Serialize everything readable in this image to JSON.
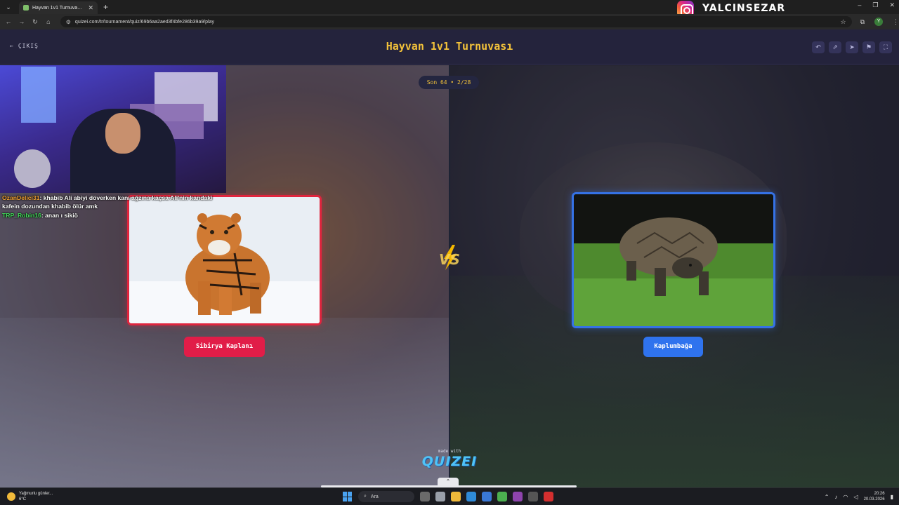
{
  "browser": {
    "tab_title": "Hayvan 1v1 Turnuvası - Tier Li...",
    "url": "quizei.com/tr/tournament/quiz/69b6aa2aed3f4bfe286b39a9/play"
  },
  "overlay": {
    "instagram_handle": "YALCINSEZAR"
  },
  "header": {
    "exit_label": "ÇIKIŞ",
    "title": "Hayvan 1v1 Turnuvası"
  },
  "round": {
    "label": "Son 64 • 2/28"
  },
  "left_choice": {
    "name": "Sibirya Kaplanı",
    "accent": "#e11d48"
  },
  "right_choice": {
    "name": "Kaplumbağa",
    "accent": "#2f73ee"
  },
  "vs_label": "VS",
  "footer": {
    "made_with": "made with",
    "brand": "QUIZEI"
  },
  "chat": [
    {
      "user": "OzanDelici31",
      "message": "khabib Ali abiyi döverken kanı ağzına kaçsa Ali'nin kandaki kafein dozundan khabib ölür amk"
    },
    {
      "user": "TRP_Robin16",
      "message": "anan ı sikiö"
    }
  ],
  "taskbar": {
    "weather_line1": "Yağmurlu günler...",
    "weather_line2": "6°C",
    "search_placeholder": "Ara",
    "time": "20:26",
    "date": "20.03.2026"
  }
}
